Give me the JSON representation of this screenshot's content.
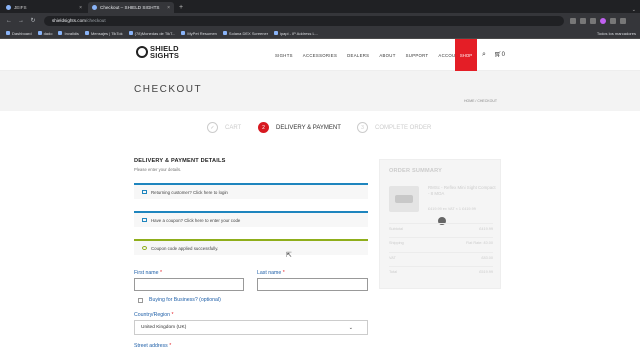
{
  "browser": {
    "tabs": [
      {
        "title": "JEIFS",
        "active": false
      },
      {
        "title": "Checkout – SHIELD SIGHTS",
        "active": true
      }
    ],
    "new_tab": "+",
    "tab_close": "×",
    "window_menu": "⌄",
    "url_domain": "shieldsights.com",
    "url_path": "/checkout",
    "bookmarks": [
      "Dashboard",
      "dado",
      "Invalidis",
      "Mensajes | TikTok",
      "(78)Monedas de TikT...",
      "MyPet Resumen",
      "Solana DEX Screener",
      "ipapi - IP Address L..."
    ],
    "bookmarks_all": "Todos los marcadores"
  },
  "site": {
    "logo_line1": "SHIELD",
    "logo_line2": "SIGHTS",
    "menu": [
      "SIGHTS",
      "ACCESSORIES",
      "DEALERS",
      "ABOUT",
      "SUPPORT",
      "ACCOUNT"
    ],
    "shop": "SHOP",
    "cart_count": "0",
    "page_title": "CHECKOUT",
    "breadcrumb": "HOME / CHECKOUT"
  },
  "steps": [
    {
      "num": "✓",
      "label": "CART"
    },
    {
      "num": "2",
      "label": "DELIVERY & PAYMENT"
    },
    {
      "num": "3",
      "label": "COMPLETE ORDER"
    }
  ],
  "form": {
    "heading": "DELIVERY & PAYMENT DETAILS",
    "subheading": "Please enter your details.",
    "notice_returning": "Returning customer? Click here to login",
    "notice_coupon": "Have a coupon? Click here to enter your code",
    "notice_applied": "Coupon code applied successfully.",
    "first_name_label": "First name",
    "last_name_label": "Last name",
    "required_mark": "*",
    "business_label": "Buying for Business? (optional)",
    "country_label": "Country/Region",
    "country_value": "United Kingdom (UK)",
    "street_label": "Street address"
  },
  "summary": {
    "title": "ORDER SUMMARY",
    "product_name": "RMSc - Reflex Mini Sight Compact - 8 MOA",
    "product_price": "£419.99 ex VAT × 1 £419.99",
    "rows": [
      {
        "label": "Subtotal",
        "value": "£419.99"
      },
      {
        "label": "Shipping",
        "value": "Flat Rate: £0.00"
      },
      {
        "label": "VAT",
        "value": "£83.00"
      },
      {
        "label": "Total",
        "value": "£519.99"
      }
    ]
  },
  "colors": {
    "accent_red": "#e41e26",
    "link_blue": "#1e5fa8",
    "notice_blue": "#1e85be",
    "success_green": "#8fae1b"
  }
}
